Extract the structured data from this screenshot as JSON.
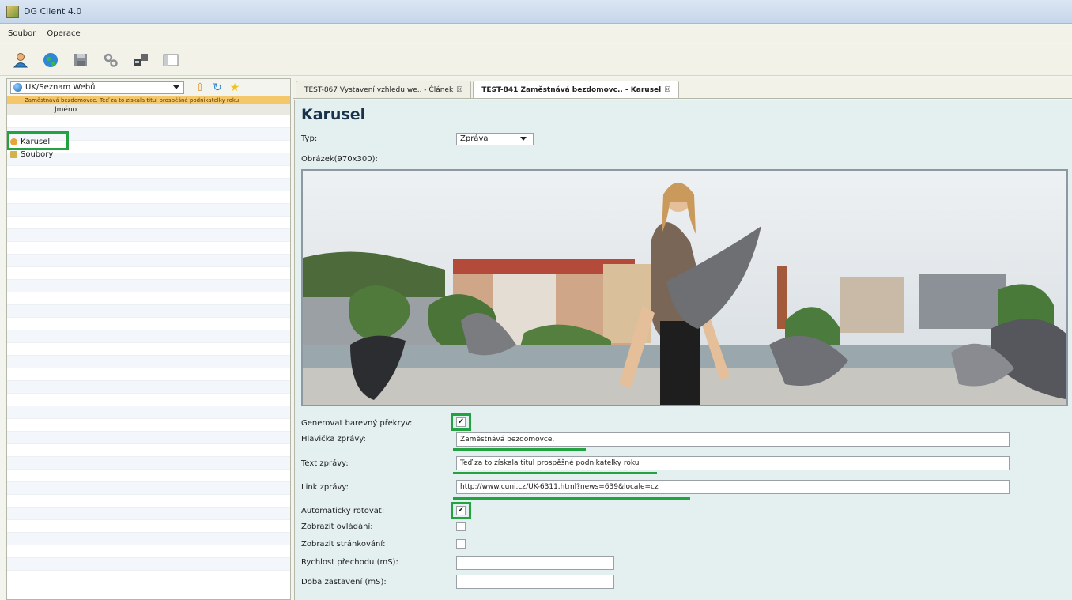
{
  "window": {
    "title": "DG Client 4.0"
  },
  "menu": [
    "Soubor",
    "Operace"
  ],
  "toolbar_icons": [
    "user-icon",
    "globe-icon",
    "save-icon",
    "settings-icon",
    "network-icon",
    "panel-icon"
  ],
  "left": {
    "site": "UK/Seznam Webů",
    "path": "Zaměstnává bezdomovce. Teď za to získala titul prospěšné podnikatelky roku",
    "column_header": "Jméno",
    "items": [
      "Karusel",
      "Soubory"
    ]
  },
  "tabs": [
    {
      "label": "TEST-867 Vystavení vzhledu we.. - Článek",
      "active": false
    },
    {
      "label": "TEST-841 Zaměstnává bezdomovc.. - Karusel",
      "active": true
    }
  ],
  "form": {
    "title": "Karusel",
    "type_label": "Typ:",
    "type_value": "Zpráva",
    "image_label": "Obrázek(970x300):",
    "overlay_label": "Generovat barevný překryv:",
    "overlay_checked": true,
    "headline_label": "Hlavička zprávy:",
    "headline_value": "Zaměstnává bezdomovce.",
    "text_label": "Text zprávy:",
    "text_value": "Teď za to získala titul prospěšné podnikatelky roku",
    "link_label": "Link zprávy:",
    "link_value": "http://www.cuni.cz/UK-6311.html?news=639&locale=cz",
    "autorotate_label": "Automaticky rotovat:",
    "autorotate_checked": true,
    "controls_label": "Zobrazit ovládání:",
    "controls_checked": false,
    "paging_label": "Zobrazit stránkování:",
    "paging_checked": false,
    "speed_label": "Rychlost přechodu (mS):",
    "speed_value": "",
    "pause_label": "Doba zastavení (mS):",
    "pause_value": ""
  },
  "colors": {
    "highlight": "#22a240",
    "panel_bg": "#e4f0f0",
    "title": "#19324a"
  }
}
